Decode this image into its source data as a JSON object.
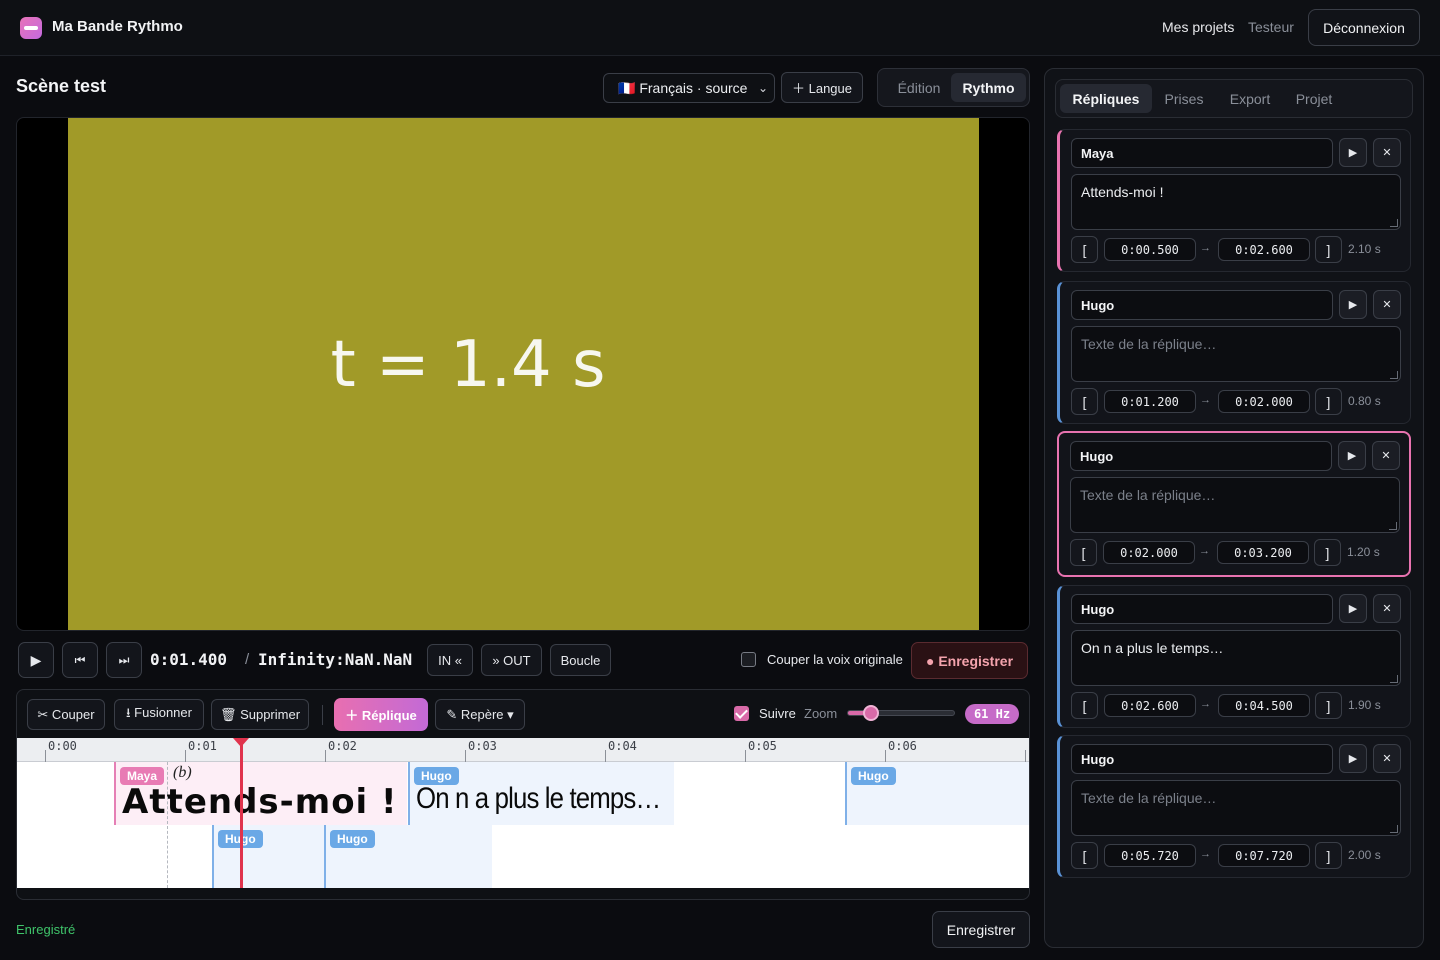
{
  "app": {
    "brand": "Ma Bande Rythmo"
  },
  "nav": {
    "projects": "Mes projets",
    "tester": "Testeur",
    "logout": "Déconnexion"
  },
  "scene": {
    "title": "Scène test",
    "language": "🇫🇷 Français · source",
    "add_language": "＋ Langue",
    "mode_edit": "Édition",
    "mode_rythmo": "Rythmo",
    "active_mode": "Rythmo"
  },
  "video": {
    "overlay_text": "t = 1.4 s",
    "frame_color": "#a19a28"
  },
  "transport": {
    "play": "▶",
    "prev": "⏮",
    "next": "⏭",
    "current": "0:01.400",
    "separator": "/",
    "duration": "Infinity:NaN.NaN",
    "mark_in": "IN «",
    "mark_out": "» OUT",
    "loop": "Boucle",
    "cut_voice": "Couper la voix originale",
    "cut_voice_checked": false,
    "record": "● Enregistrer"
  },
  "timeline_toolbar": {
    "cut": "✂ Couper",
    "merge": "⭳ Fusionner",
    "delete": "🗑 Supprimer",
    "add_line": "＋ Réplique",
    "marker": "✎ Repère ▾",
    "follow": "Suivre",
    "follow_checked": true,
    "zoom_label": "Zoom",
    "zoom_value": 0.22,
    "hz": "61 Hz"
  },
  "timeline": {
    "ticks": [
      "0:00",
      "0:01",
      "0:02",
      "0:03",
      "0:04",
      "0:05",
      "0:06"
    ],
    "playhead_seconds": 1.4,
    "marker_seconds": 0.87,
    "annotation": "(b)",
    "track1": [
      {
        "speaker": "Maya",
        "text": "Attends-moi !",
        "color": "pink"
      },
      {
        "speaker": "Hugo",
        "text": "On n a plus le temps…",
        "color": "blue"
      },
      {
        "speaker": "Hugo",
        "text": "",
        "color": "blue"
      }
    ],
    "track2": [
      {
        "speaker": "Hugo",
        "text": "",
        "color": "blue"
      },
      {
        "speaker": "Hugo",
        "text": "",
        "color": "blue"
      }
    ]
  },
  "footer": {
    "status": "Enregistré",
    "save": "Enregistrer"
  },
  "right_panel": {
    "tabs": [
      "Répliques",
      "Prises",
      "Export",
      "Projet"
    ],
    "active_tab": "Répliques",
    "placeholder": "Texte de la réplique…",
    "cards": [
      {
        "speaker": "Maya",
        "text": "Attends-moi !",
        "start": "0:00.500",
        "end": "0:02.600",
        "duration": "2.10 s",
        "color": "pink",
        "selected": false
      },
      {
        "speaker": "Hugo",
        "text": "",
        "start": "0:01.200",
        "end": "0:02.000",
        "duration": "0.80 s",
        "color": "blue",
        "selected": false
      },
      {
        "speaker": "Hugo",
        "text": "",
        "start": "0:02.000",
        "end": "0:03.200",
        "duration": "1.20 s",
        "color": "blue",
        "selected": true
      },
      {
        "speaker": "Hugo",
        "text": "On n a plus le temps…",
        "start": "0:02.600",
        "end": "0:04.500",
        "duration": "1.90 s",
        "color": "blue",
        "selected": false
      },
      {
        "speaker": "Hugo",
        "text": "",
        "start": "0:05.720",
        "end": "0:07.720",
        "duration": "2.00 s",
        "color": "blue",
        "selected": false
      }
    ]
  },
  "icons": {
    "play": "play-icon",
    "close": "close-icon"
  },
  "colors": {
    "accent": "#e873b0",
    "speaker_pink": "#e873b0",
    "speaker_blue": "#6aa8e6",
    "playhead": "#e0334d",
    "saved": "#3fc46a"
  }
}
